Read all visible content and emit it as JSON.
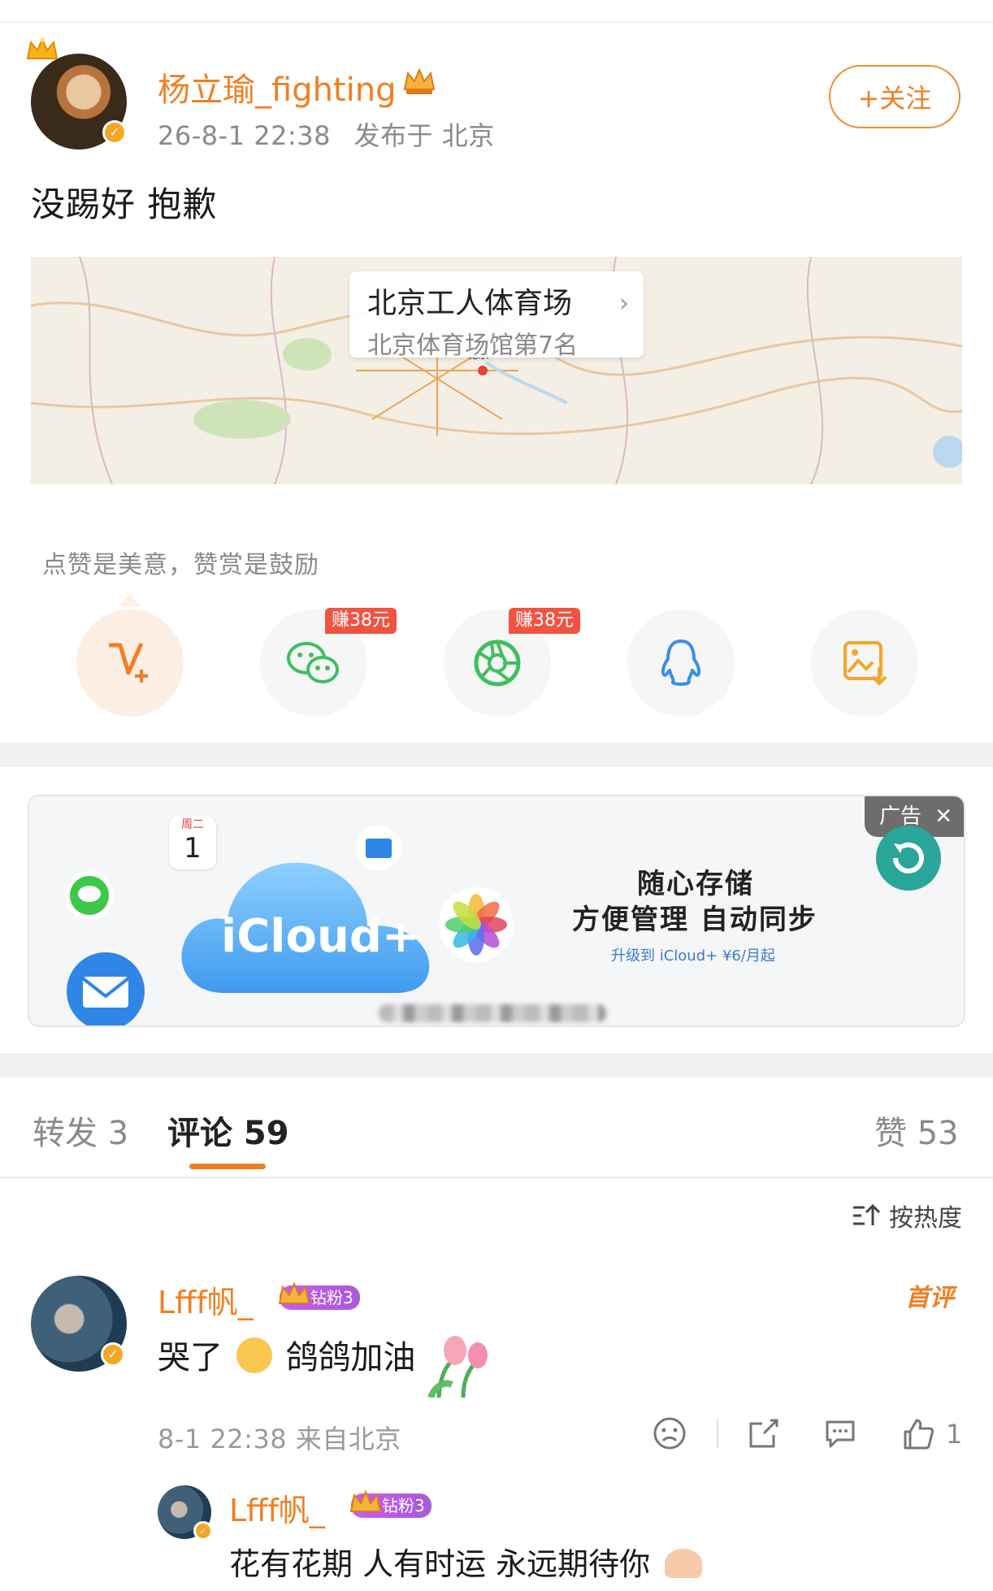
{
  "post": {
    "username": "杨立瑜_fighting",
    "timestamp": "26-8-1 22:38",
    "location": "发布于 北京",
    "follow_label": "+关注",
    "text": "没踢好 抱歉"
  },
  "map": {
    "place_title": "北京工人体育场",
    "place_subtitle": "北京体育场馆第7名",
    "city_label": "北京"
  },
  "reward": {
    "prompt": "点赞是美意，赞赏是鼓励",
    "share_targets": [
      {
        "icon": "v-reward-icon"
      },
      {
        "icon": "wechat-icon",
        "tag": "赚38元"
      },
      {
        "icon": "moments-icon",
        "tag": "赚38元"
      },
      {
        "icon": "qq-icon"
      },
      {
        "icon": "save-image-icon"
      }
    ]
  },
  "ad": {
    "tag": "广告",
    "calendar_day": "周二",
    "calendar_date": "1",
    "product": "iCloud+",
    "line1": "随心存储",
    "line2": "方便管理 自动同步",
    "line3": "升级到 iCloud+ ¥6/月起"
  },
  "tabs": {
    "repost": "转发 3",
    "comment": "评论 59",
    "like": "赞 53"
  },
  "sort_label": "按热度",
  "comments": [
    {
      "username": "Lfff帆_",
      "fan_badge": "钻粉3",
      "first_tag": "首评",
      "text_a": "哭了",
      "text_b": "鸽鸽加油",
      "meta": "8-1 22:38 来自北京",
      "like_count": "1"
    }
  ],
  "reply": {
    "username": "Lfff帆_",
    "fan_badge": "钻粉3",
    "text": "花有花期 人有时运 永远期待你"
  },
  "colors": {
    "accent": "#f07f22",
    "fan_badge": "#b45be4",
    "earn_tag": "#f05440"
  }
}
